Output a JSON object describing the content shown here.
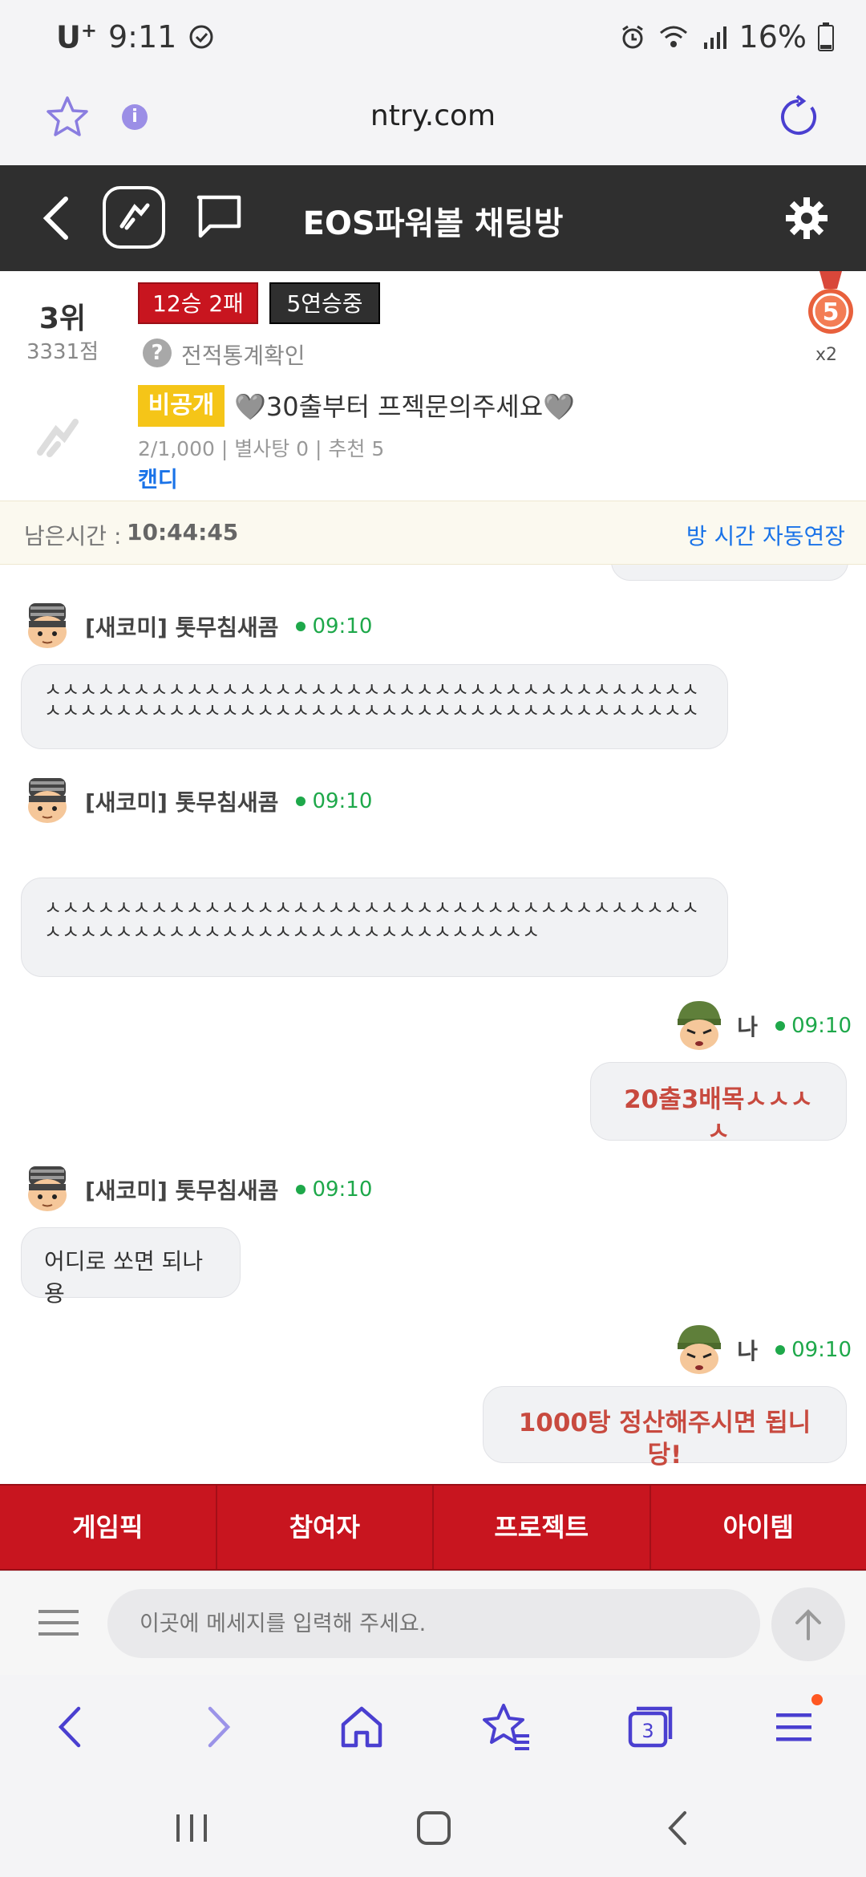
{
  "status_bar": {
    "carrier": "U",
    "carrier_sup": "+",
    "time": "9:11",
    "battery": "16%"
  },
  "browser": {
    "url": "ntry.com",
    "info_glyph": "i"
  },
  "header": {
    "title": "EOS파워볼 채팅방"
  },
  "room": {
    "rank": "3위",
    "score": "3331점",
    "record": "12승 2패",
    "streak": "5연승중",
    "help_glyph": "?",
    "stats_link": "전적통계확인",
    "medal_count": "x2",
    "private_badge": "비공개",
    "name": "🩶30출부터 프젝문의주세요🩶",
    "meta": "2/1,000 | 별사탕 0 | 추천 5",
    "owner": "캔디"
  },
  "remain": {
    "label": "남은시간 :",
    "time": "10:44:45",
    "extend_link": "방 시간 자동연장"
  },
  "messages": [
    {
      "nick": "[새코미] 톳무침새콤",
      "time": "09:10",
      "text": "ㅅㅅㅅㅅㅅㅅㅅㅅㅅㅅㅅㅅㅅㅅㅅㅅㅅㅅㅅㅅㅅㅅㅅㅅㅅㅅㅅㅅㅅㅅㅅㅅㅅㅅㅅㅅㅅㅅㅅㅅㅅㅅㅅㅅㅅㅅㅅㅅㅅㅅㅅㅅㅅㅅㅅㅅㅅㅅㅅㅅㅅㅅㅅㅅㅅㅅㅅㅅㅅㅅㅅㅅㅅㅅ"
    },
    {
      "nick": "[새코미] 톳무침새콤",
      "time": "09:10",
      "text": "ㅅㅅㅅㅅㅅㅅㅅㅅㅅㅅㅅㅅㅅㅅㅅㅅㅅㅅㅅㅅㅅㅅㅅㅅㅅㅅㅅㅅㅅㅅㅅㅅㅅㅅㅅㅅㅅㅅㅅㅅㅅㅅㅅㅅㅅㅅㅅㅅㅅㅅㅅㅅㅅㅅㅅㅅㅅㅅㅅㅅㅅㅅㅅㅅㅅ"
    },
    {
      "nick": "나",
      "time": "09:10",
      "text": "20출3배목ㅅㅅㅅㅅ"
    },
    {
      "nick": "[새코미] 톳무침새콤",
      "time": "09:10",
      "text": "어디로 쏘면 되나용"
    },
    {
      "nick": "나",
      "time": "09:10",
      "text": "1000탕 정산해주시면 됩니당!"
    }
  ],
  "tabs": [
    "게임픽",
    "참여자",
    "프로젝트",
    "아이템"
  ],
  "input": {
    "placeholder": "이곳에 메세지를 입력해 주세요."
  },
  "browser_nav": {
    "tabs_count": "3"
  },
  "colors": {
    "accent_red": "#c8151f",
    "header_dark": "#2f2f2f",
    "time_green": "#1ea84a",
    "link_blue": "#1a73e8",
    "browser_purple": "#5b4fe0"
  },
  "icons": [
    "star-icon",
    "info-icon",
    "refresh-icon",
    "back-icon",
    "logo-icon",
    "chat-icon",
    "gear-icon",
    "help-icon",
    "medal-icon",
    "room-icon",
    "menu-icon",
    "send-arrow-icon",
    "home-icon",
    "bookmarks-icon",
    "tabs-icon"
  ]
}
